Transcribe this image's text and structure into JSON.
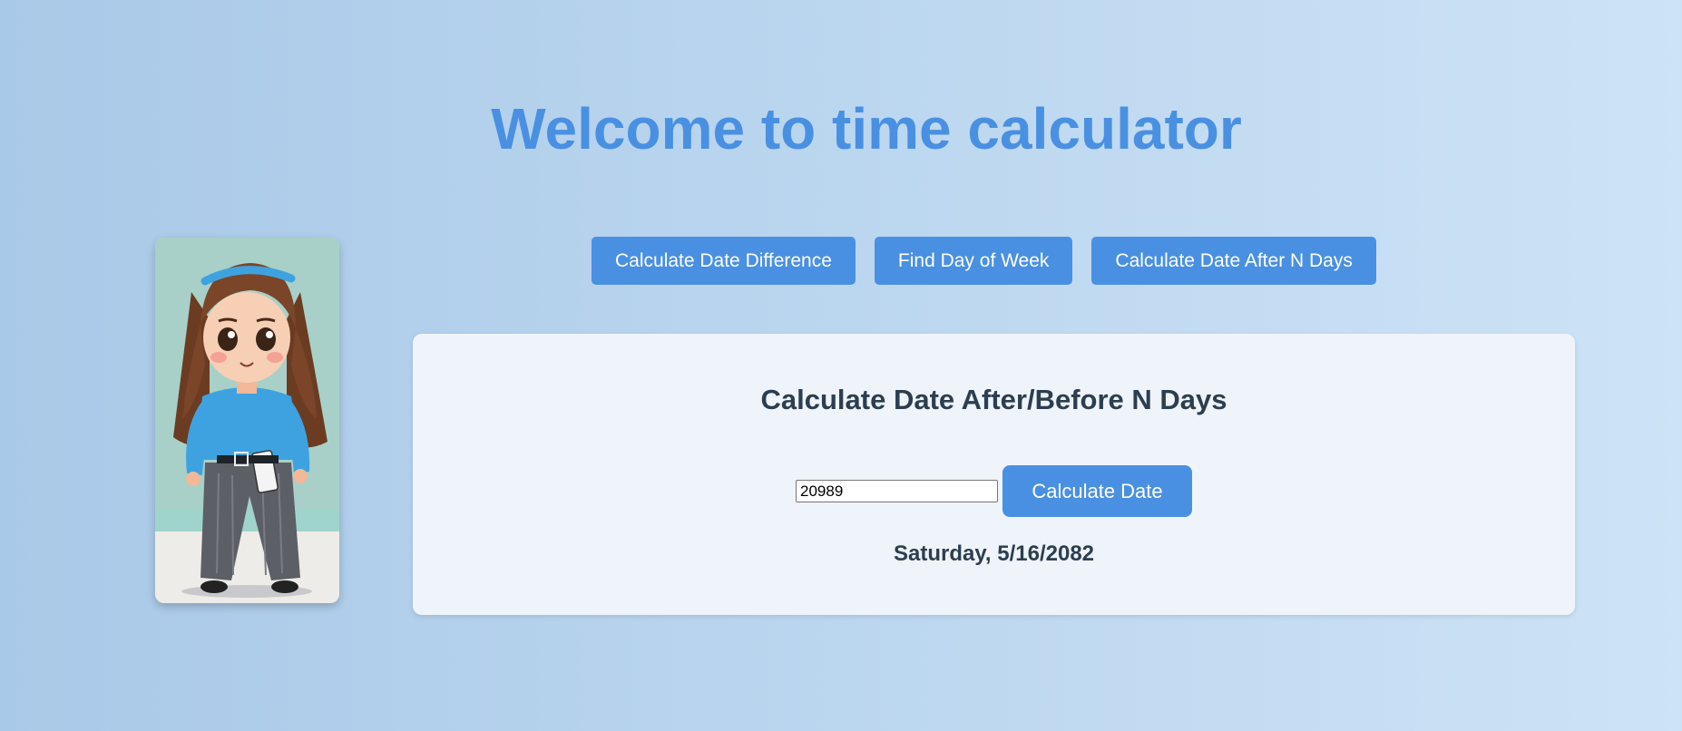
{
  "header": {
    "title": "Welcome to time calculator"
  },
  "nav": {
    "buttons": [
      {
        "label": "Calculate Date Difference"
      },
      {
        "label": "Find Day of Week"
      },
      {
        "label": "Calculate Date After N Days"
      }
    ]
  },
  "panel": {
    "title": "Calculate Date After/Before N Days",
    "days_input": {
      "value": "20989"
    },
    "calculate_button": "Calculate Date",
    "result": "Saturday, 5/16/2082"
  },
  "theme": {
    "accent": "#4a90e2",
    "text_dark": "#2c3e50",
    "panel_bg": "#eff4fa"
  }
}
